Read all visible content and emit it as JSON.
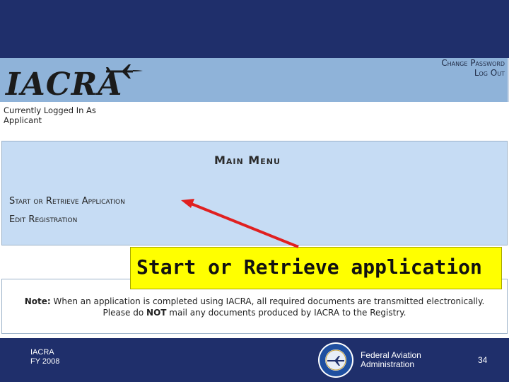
{
  "header": {
    "logo_text": "IACRA",
    "links": [
      {
        "label": "Change Password"
      },
      {
        "label": "Log Out"
      }
    ],
    "logged_in_line1": "Currently Logged In As",
    "logged_in_line2": "Applicant"
  },
  "main_menu": {
    "title": "Main Menu",
    "items": [
      {
        "label": "Start or Retrieve Application"
      },
      {
        "label": "Edit Registration"
      }
    ]
  },
  "callout": {
    "text": "Start or Retrieve application",
    "color": "#ffff00",
    "arrow_color": "#e02020"
  },
  "note": {
    "label": "Note:",
    "line1": "When an application is completed using IACRA, all required documents are transmitted electronically.",
    "line2_pre": "Please do ",
    "line2_bold": "NOT",
    "line2_post": " mail any documents produced by IACRA to the Registry."
  },
  "footer": {
    "left_line1": "IACRA",
    "left_line2": "FY 2008",
    "faa_line1": "Federal Aviation",
    "faa_line2": "Administration",
    "page_number": "34",
    "seal_icon": "faa-seal-icon"
  },
  "colors": {
    "top_bar": "#1f2f6b",
    "header_bg": "#8fb3d9",
    "menu_bg": "#c6dcf4"
  }
}
